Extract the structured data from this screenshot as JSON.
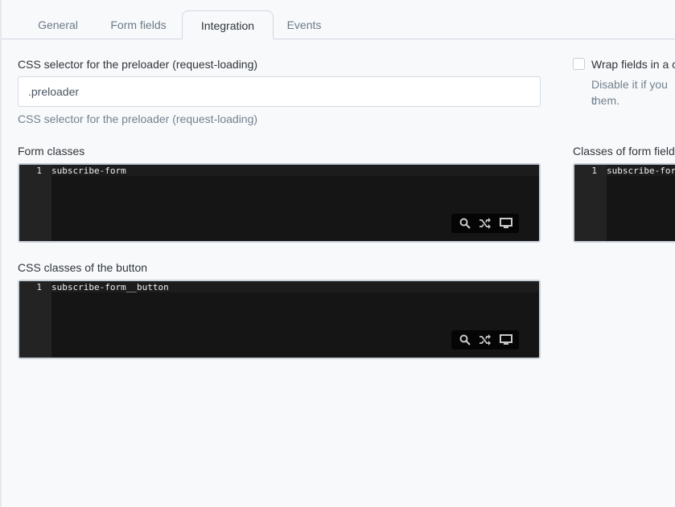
{
  "tabs": [
    {
      "label": "General"
    },
    {
      "label": "Form fields"
    },
    {
      "label": "Integration"
    },
    {
      "label": "Events"
    }
  ],
  "preloader": {
    "label": "CSS selector for the preloader (request-loading)",
    "value": ".preloader",
    "help": "CSS selector for the preloader (request-loading)"
  },
  "wrap_fields": {
    "label": "Wrap fields in a c",
    "help_line1": "Disable it if you c",
    "help_line2": "them."
  },
  "form_classes": {
    "label": "Form classes",
    "line_number": "1",
    "code": "subscribe-form"
  },
  "field_classes": {
    "label": "Classes of form fields",
    "line_number": "1",
    "code": "subscribe-for"
  },
  "button_classes": {
    "label": "CSS classes of the button",
    "line_number": "1",
    "code": "subscribe-form__button"
  },
  "editor_toolbar": {
    "icons": [
      "search-icon",
      "shuffle-icon",
      "monitor-icon"
    ]
  },
  "colors": {
    "background": "#f8f9fb",
    "editor_background": "#151515",
    "gutter": "#232323",
    "tab_border": "#cfd8e3"
  }
}
